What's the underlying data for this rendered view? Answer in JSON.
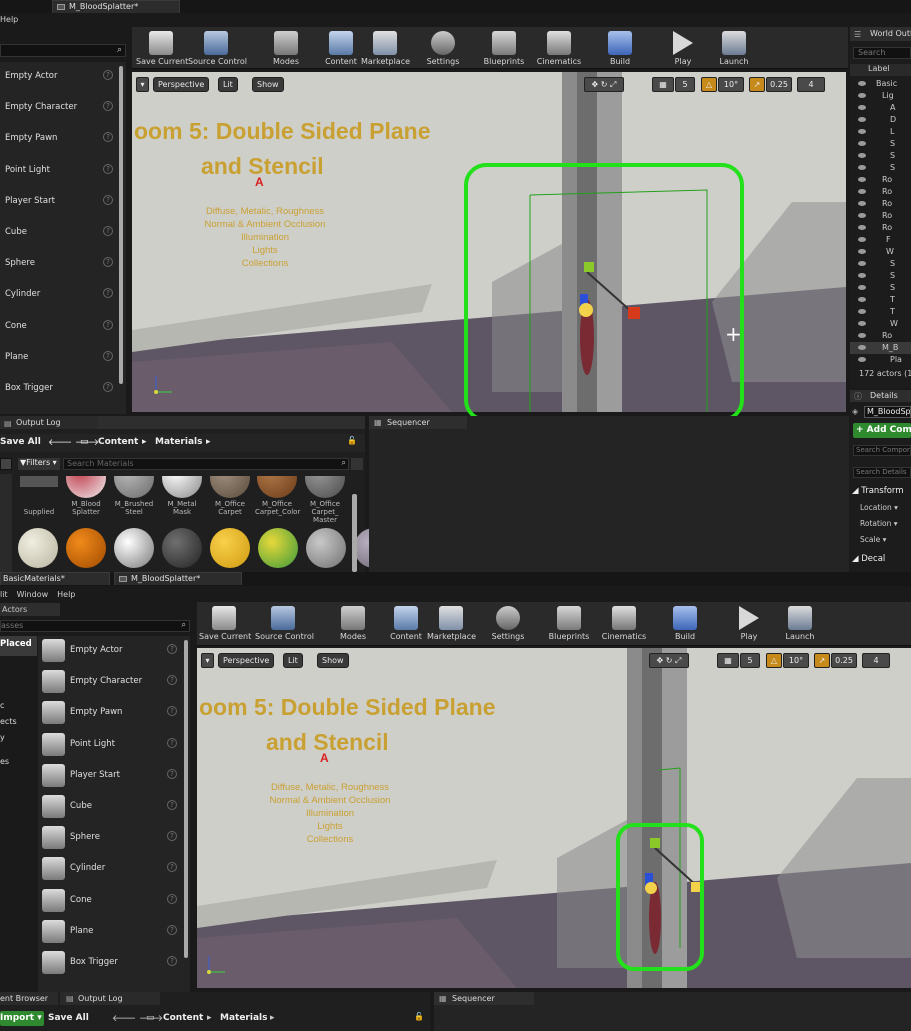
{
  "top": {
    "tabs": [
      {
        "label": "M_BloodSplatter*"
      }
    ],
    "menu": [
      "Help"
    ],
    "toolbar": [
      {
        "label": "Save Current",
        "icon": "save-icon"
      },
      {
        "label": "Source Control",
        "icon": "source-control-icon"
      },
      {
        "label": "Modes",
        "icon": "modes-icon"
      },
      {
        "label": "Content",
        "icon": "content-icon"
      },
      {
        "label": "Marketplace",
        "icon": "marketplace-icon"
      },
      {
        "label": "Settings",
        "icon": "settings-icon"
      },
      {
        "label": "Blueprints",
        "icon": "blueprints-icon"
      },
      {
        "label": "Cinematics",
        "icon": "cinematics-icon"
      },
      {
        "label": "Build",
        "icon": "build-icon"
      },
      {
        "label": "Play",
        "icon": "play-icon"
      },
      {
        "label": "Launch",
        "icon": "launch-icon"
      }
    ],
    "modes_items": [
      "Empty Actor",
      "Empty Character",
      "Empty Pawn",
      "Point Light",
      "Player Start",
      "Cube",
      "Sphere",
      "Cylinder",
      "Cone",
      "Plane",
      "Box Trigger"
    ],
    "viewport": {
      "perspective": "Perspective",
      "lit": "Lit",
      "show": "Show",
      "snap": "5",
      "rot": "10°",
      "scale": "0.25",
      "cam": "4",
      "wall_title_1": "oom 5: Double Sided Plane",
      "wall_title_2": "and Stencil",
      "wall_marker": "A",
      "wall_sub": [
        "Diffuse, Metalic, Roughness",
        "Normal & Ambient Occlusion",
        "Illumination",
        "Lights",
        "Collections"
      ]
    },
    "outliner": {
      "title": "World Outliner",
      "search": "Search",
      "col": "Label",
      "rows": [
        "Basic",
        "Lig",
        "A",
        "D",
        "L",
        "S",
        "S",
        "S",
        "Ro",
        "Ro",
        "Ro",
        "Ro",
        "Ro",
        "F",
        "W",
        "S",
        "S",
        "S",
        "T",
        "T",
        "W",
        "Ro",
        "M_B",
        "Pla"
      ],
      "footer": "172 actors (1 s"
    },
    "details": {
      "title": "Details",
      "name": "M_BloodSpl",
      "add": "+ Add Comp",
      "search_comp": "Search Compor",
      "search": "Search Details",
      "transform": "Transform",
      "location": "Location",
      "rotation": "Rotation",
      "scale": "Scale",
      "decal": "Decal"
    },
    "bottom": {
      "output_log": "Output Log",
      "sequencer": "Sequencer",
      "save_all": "Save All",
      "breadcrumb": [
        "Content",
        "Materials"
      ],
      "filters": "Filters",
      "search": "Search Materials",
      "supplied": "Supplied",
      "assets": [
        "M_Blood Splatter",
        "M_Brushed Steel",
        "M_Metal Mask",
        "M_Office Carpet",
        "M_Office Carpet_Color",
        "M_Office Carpet_ Master"
      ]
    }
  },
  "bot": {
    "tabs": [
      {
        "label": "BasicMaterials*"
      },
      {
        "label": "M_BloodSplatter*"
      }
    ],
    "menu": [
      "lit",
      "Window",
      "Help"
    ],
    "place": {
      "title": "Actors",
      "search": "asses",
      "recent": "Placed",
      "cats": [
        "c",
        "ects",
        "y",
        "es"
      ]
    },
    "modes_items": [
      "Empty Actor",
      "Empty Character",
      "Empty Pawn",
      "Point Light",
      "Player Start",
      "Cube",
      "Sphere",
      "Cylinder",
      "Cone",
      "Plane",
      "Box Trigger"
    ],
    "viewport": {
      "perspective": "Perspective",
      "lit": "Lit",
      "show": "Show",
      "snap": "5",
      "rot": "10°",
      "scale": "0.25",
      "cam": "4",
      "wall_title_1": "oom 5: Double Sided Plane",
      "wall_title_2": "and Stencil",
      "wall_marker": "A",
      "wall_sub": [
        "Diffuse, Metalic, Roughness",
        "Normal & Ambient Occlusion",
        "Illumination",
        "Lights",
        "Collections"
      ]
    },
    "bottom": {
      "content_browser": "ent Browser",
      "output_log": "Output Log",
      "sequencer": "Sequencer",
      "import": "Import",
      "save_all": "Save All",
      "breadcrumb": [
        "Content",
        "Materials"
      ]
    }
  },
  "colors": {
    "highlight": "#22e01a",
    "accent": "#c9a032",
    "panel": "#242424"
  }
}
